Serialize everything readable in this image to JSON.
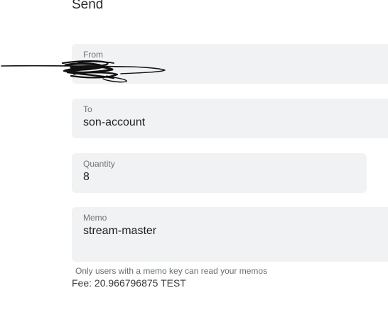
{
  "header": {
    "title": "Send"
  },
  "form": {
    "from": {
      "label": "From",
      "value": ""
    },
    "to": {
      "label": "To",
      "value": "son-account"
    },
    "quantity": {
      "label": "Quantity",
      "value": "8"
    },
    "memo": {
      "label": "Memo",
      "value": "stream-master",
      "helper": "Only users with a memo key can read your memos"
    }
  },
  "fee": {
    "text": "Fee: 20.966796875 TEST"
  },
  "colors": {
    "field_background": "#f1f2f3",
    "label": "#707478",
    "text": "#1f1f1f"
  }
}
